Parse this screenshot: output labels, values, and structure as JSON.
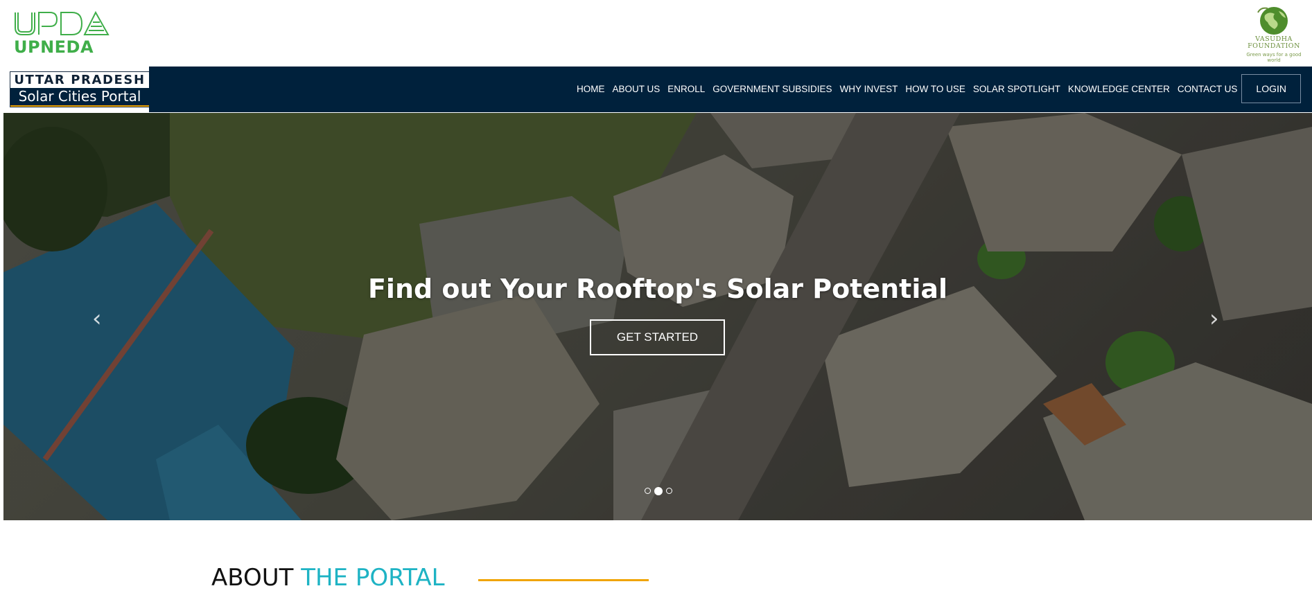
{
  "header": {
    "left_logo_text": "UPNEDA",
    "right_logo_name_line1": "VASUDHA",
    "right_logo_name_line2": "FOUNDATION",
    "right_logo_tagline": "Green ways for a good world"
  },
  "brand": {
    "line1": "UTTAR PRADESH",
    "line2": "Solar Cities Portal"
  },
  "nav": {
    "items": [
      {
        "label": "HOME"
      },
      {
        "label": "ABOUT US"
      },
      {
        "label": "ENROLL"
      },
      {
        "label": "GOVERNMENT SUBSIDIES"
      },
      {
        "label": "WHY INVEST"
      },
      {
        "label": "HOW TO USE"
      },
      {
        "label": "SOLAR SPOTLIGHT"
      },
      {
        "label": "KNOWLEDGE CENTER"
      },
      {
        "label": "CONTACT US"
      }
    ],
    "login_label": "LOGIN"
  },
  "hero": {
    "title": "Find out Your Rooftop's Solar Potential",
    "cta_label": "GET STARTED",
    "prev_glyph": "‹",
    "next_glyph": "›",
    "slides_count": 3,
    "active_slide": 2
  },
  "about": {
    "heading_part1": "ABOUT",
    "heading_part2": "THE PORTAL"
  },
  "colors": {
    "nav_bg": "#00213c",
    "accent_teal": "#1eb3c4",
    "accent_orange": "#f0a400",
    "logo_green": "#3fae49"
  }
}
